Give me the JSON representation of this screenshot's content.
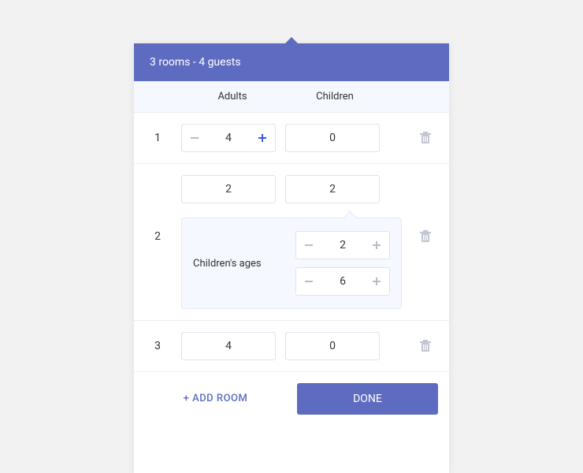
{
  "header": {
    "summary": "3 rooms - 4 guests"
  },
  "columns": {
    "adults": "Adults",
    "children": "Children"
  },
  "rooms": [
    {
      "index": "1",
      "adults": "4",
      "children": "0",
      "showSteppers": true
    },
    {
      "index": "2",
      "adults": "2",
      "children": "2",
      "agesLabel": "Children's ages",
      "ages": [
        "2",
        "6"
      ]
    },
    {
      "index": "3",
      "adults": "4",
      "children": "0"
    }
  ],
  "footer": {
    "addRoom": "+ ADD ROOM",
    "done": "DONE"
  }
}
